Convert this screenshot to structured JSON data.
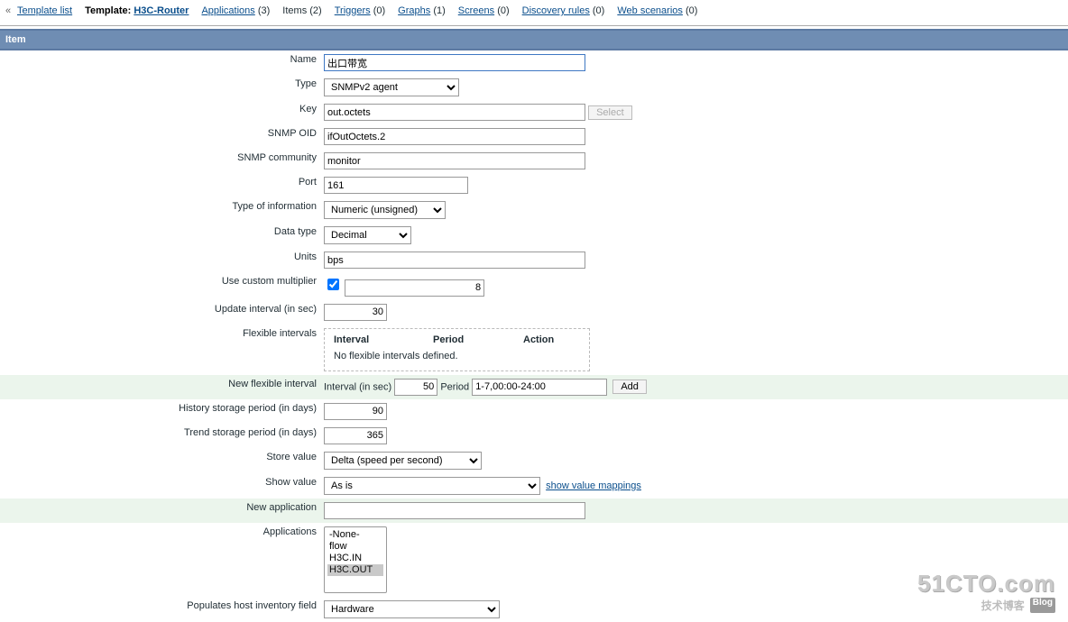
{
  "breadcrumb": {
    "back_glyph": "«",
    "template_list": "Template list",
    "template_label": "Template:",
    "template_name": "H3C-Router",
    "applications": "Applications",
    "applications_count": "(3)",
    "items": "Items",
    "items_count": "(2)",
    "triggers": "Triggers",
    "triggers_count": "(0)",
    "graphs": "Graphs",
    "graphs_count": "(1)",
    "screens": "Screens",
    "screens_count": "(0)",
    "discovery": "Discovery rules",
    "discovery_count": "(0)",
    "web": "Web scenarios",
    "web_count": "(0)"
  },
  "title": "Item",
  "labels": {
    "name": "Name",
    "type": "Type",
    "key": "Key",
    "snmp_oid": "SNMP OID",
    "snmp_community": "SNMP community",
    "port": "Port",
    "type_of_information": "Type of information",
    "data_type": "Data type",
    "units": "Units",
    "use_custom_multiplier": "Use custom multiplier",
    "update_interval": "Update interval (in sec)",
    "flexible_intervals": "Flexible intervals",
    "new_flexible_interval": "New flexible interval",
    "history_storage": "History storage period (in days)",
    "trend_storage": "Trend storage period (in days)",
    "store_value": "Store value",
    "show_value": "Show value",
    "new_application": "New application",
    "applications": "Applications",
    "populates_inventory": "Populates host inventory field"
  },
  "values": {
    "name": "出口带宽",
    "type": "SNMPv2 agent",
    "key": "out.octets",
    "select_btn": "Select",
    "snmp_oid": "ifOutOctets.2",
    "snmp_community": "monitor",
    "port": "161",
    "type_of_information": "Numeric (unsigned)",
    "data_type": "Decimal",
    "units": "bps",
    "multiplier_checked": true,
    "multiplier_value": "8",
    "update_interval": "30",
    "flex_headers": {
      "interval": "Interval",
      "period": "Period",
      "action": "Action"
    },
    "flex_empty": "No flexible intervals defined.",
    "new_flex_interval_label": "Interval (in sec)",
    "new_flex_interval_value": "50",
    "new_flex_period_label": "Period",
    "new_flex_period_value": "1-7,00:00-24:00",
    "add_btn": "Add",
    "history_storage": "90",
    "trend_storage": "365",
    "store_value": "Delta (speed per second)",
    "show_value": "As is",
    "show_value_mappings": "show value mappings",
    "new_application": "",
    "applications_options": [
      "-None-",
      "flow",
      "H3C.IN",
      "H3C.OUT"
    ],
    "applications_selected": "H3C.OUT",
    "populates_inventory": "Hardware"
  },
  "watermark": {
    "big": "51CTO.com",
    "sub": "技术博客",
    "blog": "Blog"
  }
}
